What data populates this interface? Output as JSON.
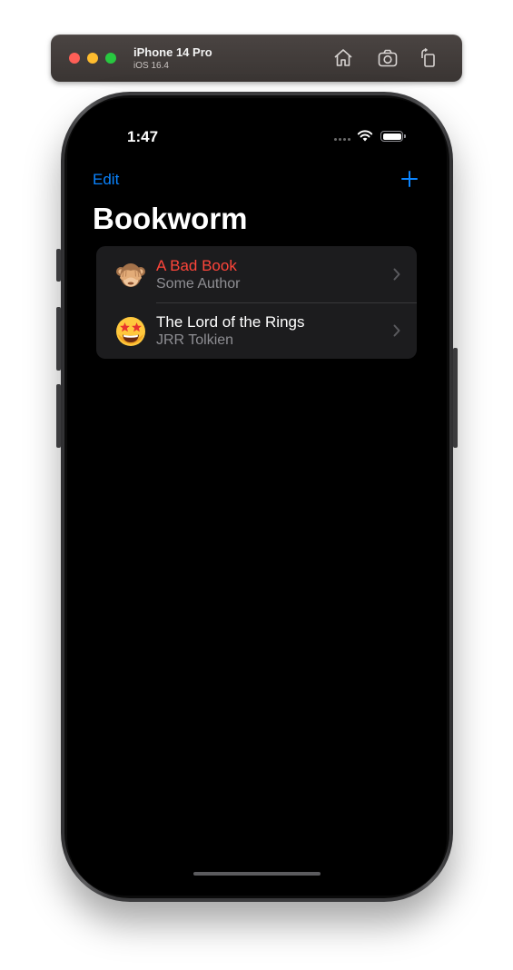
{
  "simulator": {
    "device_name": "iPhone 14 Pro",
    "os_version": "iOS 16.4",
    "toolbar_icons": [
      "home-icon",
      "screenshot-icon",
      "rotate-icon"
    ]
  },
  "status_bar": {
    "time": "1:47"
  },
  "nav": {
    "edit_label": "Edit",
    "add_icon": "plus-icon",
    "title": "Bookworm"
  },
  "books": [
    {
      "title": "A Bad Book",
      "author": "Some Author",
      "emoji": "see-no-evil-monkey",
      "title_color": "#ff453a"
    },
    {
      "title": "The Lord of the Rings",
      "author": "JRR Tolkien",
      "emoji": "star-struck-face",
      "title_color": "#ffffff"
    }
  ],
  "colors": {
    "accent": "#0a84ff",
    "bad_rating": "#ff453a",
    "background": "#000000",
    "cell": "#1c1c1e"
  }
}
